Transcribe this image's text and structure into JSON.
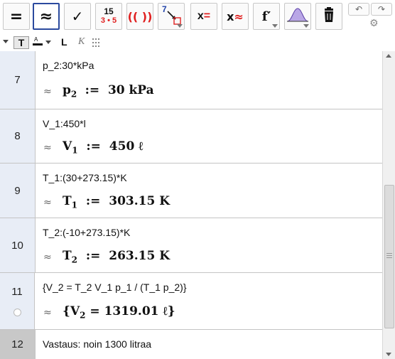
{
  "toolbar": {
    "buttons": [
      {
        "name": "evaluate-button",
        "label": "="
      },
      {
        "name": "numeric-button",
        "label": "≈"
      },
      {
        "name": "keep-input-button",
        "label": "✓"
      },
      {
        "name": "factor-button",
        "top": "15",
        "bottom": "3 • 5"
      },
      {
        "name": "expand-button",
        "label": "(( ))"
      },
      {
        "name": "substitute-button",
        "label": "7"
      },
      {
        "name": "solve-button",
        "label": "x="
      },
      {
        "name": "solve-numerically-button",
        "label": "x≈"
      },
      {
        "name": "derivative-button",
        "label": "f′"
      },
      {
        "name": "probability-button",
        "label": ""
      },
      {
        "name": "delete-button",
        "label": ""
      }
    ],
    "undo_icon": "undo-icon",
    "redo_icon": "redo-icon",
    "settings_icon": "gear-icon"
  },
  "stylebar": {
    "text_button": "T",
    "color_label": "A",
    "bold_label": "L",
    "italic_label": "K"
  },
  "rows": [
    {
      "number": "7",
      "input": "p_2:30*kPa",
      "output": {
        "var": "p",
        "sub": "2",
        "value": "30 kPa"
      }
    },
    {
      "number": "8",
      "input": "V_1:450*l",
      "output": {
        "var": "V",
        "sub": "1",
        "value": "450 ℓ"
      }
    },
    {
      "number": "9",
      "input": "T_1:(30+273.15)*K",
      "output": {
        "var": "T",
        "sub": "1",
        "value": "303.15 K"
      }
    },
    {
      "number": "10",
      "input": "T_2:(-10+273.15)*K",
      "output": {
        "var": "T",
        "sub": "2",
        "value": "263.15 K"
      }
    },
    {
      "number": "11",
      "input": "{V_2 = T_2 V_1 p_1 / (T_1 p_2)}",
      "output": {
        "var": "V",
        "sub": "2",
        "value": "1319.01 ℓ"
      }
    },
    {
      "number": "12",
      "input": "Vastaus: noin 1300 litraa"
    }
  ],
  "symbols": {
    "approx": "≈",
    "define": ":=",
    "equals": "=",
    "open_brace": "{",
    "close_brace": "}"
  },
  "colors": {
    "active_border": "#2b4a9e",
    "row_number_bg": "#e8edf6",
    "selected_row_bg": "#c8c8c8",
    "red_accent": "#e02020"
  }
}
